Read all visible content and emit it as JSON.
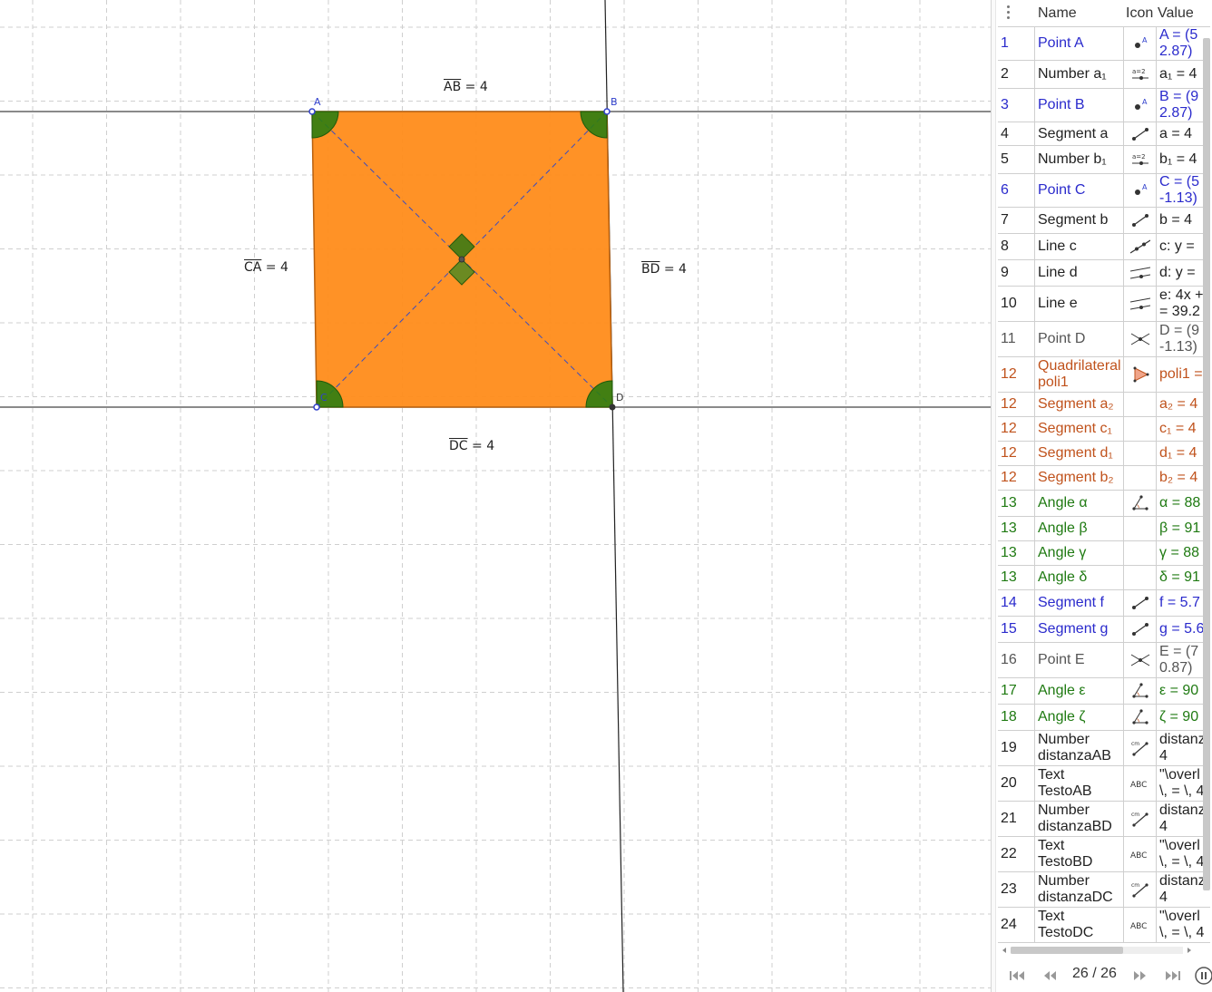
{
  "graphics": {
    "segment_labels": [
      {
        "id": "AB",
        "seg": "AB",
        "rest": " = 4"
      },
      {
        "id": "CA",
        "seg": "CA",
        "rest": " = 4"
      },
      {
        "id": "BD",
        "seg": "BD",
        "rest": " = 4"
      },
      {
        "id": "DC",
        "seg": "DC",
        "rest": " = 4"
      }
    ],
    "point_labels": {
      "A": "A",
      "B": "B",
      "C": "C",
      "D": "D"
    },
    "colors": {
      "fill": "#ff8c1a",
      "angle": "#2e7d12",
      "grid": "#cfcfcf",
      "point_blue": "#3040cc",
      "point_dark": "#333333"
    }
  },
  "algebra": {
    "headers": {
      "name": "Name",
      "icon": "Icon",
      "value": "Value"
    },
    "rows": [
      {
        "n": "1",
        "name": "Point A",
        "icon": "point-icon",
        "value": "A = (5\n2.87)",
        "color": "#2a2acc",
        "h": 37
      },
      {
        "n": "2",
        "name": "Number a₁",
        "icon": "slider-icon",
        "value": "a₁ = 4",
        "color": "#222222",
        "h": 31
      },
      {
        "n": "3",
        "name": "Point B",
        "icon": "point-icon",
        "value": "B = (9\n2.87)",
        "color": "#2a2acc",
        "h": 37
      },
      {
        "n": "4",
        "name": "Segment a",
        "icon": "segment-icon",
        "value": "a = 4",
        "color": "#222222",
        "h": 26
      },
      {
        "n": "5",
        "name": "Number b₁",
        "icon": "slider-icon",
        "value": "b₁ = 4",
        "color": "#222222",
        "h": 31
      },
      {
        "n": "6",
        "name": "Point C",
        "icon": "point-icon",
        "value": "C = (5\n-1.13)",
        "color": "#2a2acc",
        "h": 37
      },
      {
        "n": "7",
        "name": "Segment b",
        "icon": "segment-icon",
        "value": "b = 4",
        "color": "#222222",
        "h": 29
      },
      {
        "n": "8",
        "name": "Line c",
        "icon": "line-icon",
        "value": "c: y =",
        "color": "#222222",
        "h": 29
      },
      {
        "n": "9",
        "name": "Line d",
        "icon": "parallel-icon",
        "value": "d: y =",
        "color": "#222222",
        "h": 29
      },
      {
        "n": "10",
        "name": "Line e",
        "icon": "parallel-icon",
        "value": "e: 4x +\n= 39.2",
        "color": "#222222",
        "h": 39
      },
      {
        "n": "11",
        "name": "Point D",
        "icon": "intersect-icon",
        "value": "D = (9\n-1.13)",
        "color": "#555555",
        "h": 39
      },
      {
        "n": "12",
        "name": "Quadrilateral\npoli1",
        "icon": "polygon-icon",
        "value": "poli1 =",
        "color": "#c0521c",
        "h": 39
      },
      {
        "n": "12",
        "name": "Segment a₂",
        "icon": "",
        "value": "a₂ = 4",
        "color": "#c0521c",
        "h": 27
      },
      {
        "n": "12",
        "name": "Segment c₁",
        "icon": "",
        "value": "c₁ = 4",
        "color": "#c0521c",
        "h": 27
      },
      {
        "n": "12",
        "name": "Segment d₁",
        "icon": "",
        "value": "d₁ = 4",
        "color": "#c0521c",
        "h": 27
      },
      {
        "n": "12",
        "name": "Segment b₂",
        "icon": "",
        "value": "b₂ = 4",
        "color": "#c0521c",
        "h": 27
      },
      {
        "n": "13",
        "name": "Angle α",
        "icon": "angle-icon",
        "value": "α = 88",
        "color": "#1f7a12",
        "h": 29
      },
      {
        "n": "13",
        "name": "Angle β",
        "icon": "",
        "value": "β = 91",
        "color": "#1f7a12",
        "h": 27
      },
      {
        "n": "13",
        "name": "Angle γ",
        "icon": "",
        "value": "γ = 88",
        "color": "#1f7a12",
        "h": 27
      },
      {
        "n": "13",
        "name": "Angle δ",
        "icon": "",
        "value": "δ = 91",
        "color": "#1f7a12",
        "h": 27
      },
      {
        "n": "14",
        "name": "Segment f",
        "icon": "segment-icon",
        "value": "f = 5.7",
        "color": "#2a2acc",
        "h": 29
      },
      {
        "n": "15",
        "name": "Segment g",
        "icon": "segment-icon",
        "value": "g = 5.6",
        "color": "#2a2acc",
        "h": 29
      },
      {
        "n": "16",
        "name": "Point E",
        "icon": "intersect-icon",
        "value": "E = (7\n0.87)",
        "color": "#555555",
        "h": 39
      },
      {
        "n": "17",
        "name": "Angle ε",
        "icon": "angle-icon",
        "value": "ε = 90",
        "color": "#1f7a12",
        "h": 29
      },
      {
        "n": "18",
        "name": "Angle ζ",
        "icon": "angle-icon",
        "value": "ζ = 90",
        "color": "#1f7a12",
        "h": 29
      },
      {
        "n": "19",
        "name": "Number\ndistanzaAB",
        "icon": "distance-icon",
        "value": "distanz\n4",
        "color": "#222222",
        "h": 39
      },
      {
        "n": "20",
        "name": "Text\nTestoAB",
        "icon": "text-icon",
        "value": "\"\\overl\n\\, = \\, 4",
        "color": "#222222",
        "h": 39
      },
      {
        "n": "21",
        "name": "Number\ndistanzaBD",
        "icon": "distance-icon",
        "value": "distanz\n4",
        "color": "#222222",
        "h": 39
      },
      {
        "n": "22",
        "name": "Text\nTestoBD",
        "icon": "text-icon",
        "value": "\"\\overl\n\\, = \\, 4",
        "color": "#222222",
        "h": 39
      },
      {
        "n": "23",
        "name": "Number\ndistanzaDC",
        "icon": "distance-icon",
        "value": "distanz\n4",
        "color": "#222222",
        "h": 39
      },
      {
        "n": "24",
        "name": "Text\nTestoDC",
        "icon": "text-icon",
        "value": "\"\\overl\n\\, = \\, 4",
        "color": "#222222",
        "h": 39
      }
    ]
  },
  "navigation": {
    "counter": "26 / 26"
  }
}
